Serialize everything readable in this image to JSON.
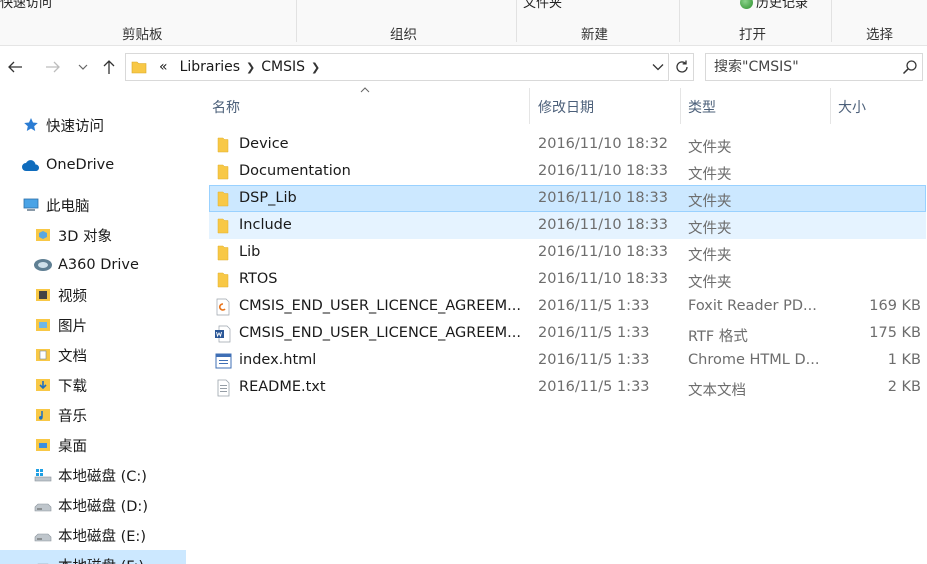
{
  "ribbon": {
    "cut_left": "快速访问",
    "cut_middle": "文件夹",
    "cut_right": "历史记录",
    "groups": [
      "剪贴板",
      "组织",
      "新建",
      "打开",
      "选择"
    ]
  },
  "address": {
    "overflow": "«",
    "segments": [
      "Libraries",
      "CMSIS"
    ]
  },
  "search": {
    "placeholder": "搜索\"CMSIS\""
  },
  "sidebar": {
    "items": [
      {
        "label": "快速访问",
        "icon": "star-icon"
      },
      {
        "label": "OneDrive",
        "icon": "cloud-icon"
      },
      {
        "label": "此电脑",
        "icon": "computer-icon"
      },
      {
        "label": "3D 对象",
        "icon": "3d-objects-icon"
      },
      {
        "label": "A360 Drive",
        "icon": "a360-drive-icon"
      },
      {
        "label": "视频",
        "icon": "video-folder-icon"
      },
      {
        "label": "图片",
        "icon": "pictures-folder-icon"
      },
      {
        "label": "文档",
        "icon": "documents-folder-icon"
      },
      {
        "label": "下载",
        "icon": "downloads-folder-icon"
      },
      {
        "label": "音乐",
        "icon": "music-folder-icon"
      },
      {
        "label": "桌面",
        "icon": "desktop-folder-icon"
      },
      {
        "label": "本地磁盘 (C:)",
        "icon": "windows-drive-icon"
      },
      {
        "label": "本地磁盘 (D:)",
        "icon": "drive-icon"
      },
      {
        "label": "本地磁盘 (E:)",
        "icon": "drive-icon"
      },
      {
        "label": "本地磁盘 (F:)",
        "icon": "drive-icon"
      }
    ]
  },
  "columns": {
    "name": "名称",
    "date": "修改日期",
    "type": "类型",
    "size": "大小"
  },
  "files": [
    {
      "name": "Device",
      "date": "2016/11/10 18:32",
      "type": "文件夹",
      "size": "",
      "icon": "folder-icon"
    },
    {
      "name": "Documentation",
      "date": "2016/11/10 18:33",
      "type": "文件夹",
      "size": "",
      "icon": "folder-icon"
    },
    {
      "name": "DSP_Lib",
      "date": "2016/11/10 18:33",
      "type": "文件夹",
      "size": "",
      "icon": "folder-icon"
    },
    {
      "name": "Include",
      "date": "2016/11/10 18:33",
      "type": "文件夹",
      "size": "",
      "icon": "folder-icon"
    },
    {
      "name": "Lib",
      "date": "2016/11/10 18:33",
      "type": "文件夹",
      "size": "",
      "icon": "folder-icon"
    },
    {
      "name": "RTOS",
      "date": "2016/11/10 18:33",
      "type": "文件夹",
      "size": "",
      "icon": "folder-icon"
    },
    {
      "name": "CMSIS_END_USER_LICENCE_AGREEM...",
      "date": "2016/11/5 1:33",
      "type": "Foxit Reader PD...",
      "size": "169 KB",
      "icon": "pdf-file-icon"
    },
    {
      "name": "CMSIS_END_USER_LICENCE_AGREEM...",
      "date": "2016/11/5 1:33",
      "type": "RTF 格式",
      "size": "175 KB",
      "icon": "rtf-file-icon"
    },
    {
      "name": "index.html",
      "date": "2016/11/5 1:33",
      "type": "Chrome HTML D...",
      "size": "1 KB",
      "icon": "html-file-icon"
    },
    {
      "name": "README.txt",
      "date": "2016/11/5 1:33",
      "type": "文本文档",
      "size": "2 KB",
      "icon": "text-file-icon"
    }
  ],
  "colors": {
    "selected_bg": "#cce8ff",
    "selected_border": "#99d1ff",
    "hover_bg": "#e5f3ff",
    "folder": "#f8c846",
    "header_text": "#4c607a"
  }
}
